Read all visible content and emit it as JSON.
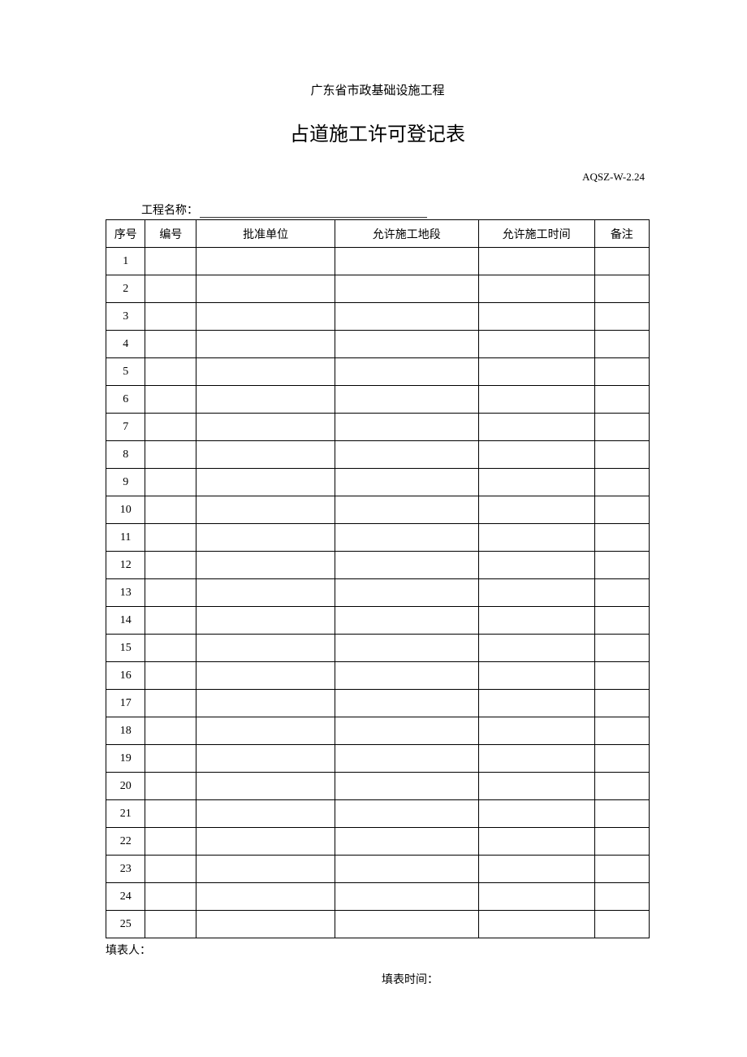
{
  "header": {
    "subtitle": "广东省市政基础设施工程",
    "title": "占道施工许可登记表",
    "doc_code": "AQSZ-W-2.24",
    "project_label": "工程名称："
  },
  "table": {
    "headers": {
      "seq": "序号",
      "num": "编号",
      "approver": "批准单位",
      "location": "允许施工地段",
      "time": "允许施工时间",
      "note": "备注"
    },
    "rows": [
      {
        "seq": "1",
        "num": "",
        "approver": "",
        "location": "",
        "time": "",
        "note": ""
      },
      {
        "seq": "2",
        "num": "",
        "approver": "",
        "location": "",
        "time": "",
        "note": ""
      },
      {
        "seq": "3",
        "num": "",
        "approver": "",
        "location": "",
        "time": "",
        "note": ""
      },
      {
        "seq": "4",
        "num": "",
        "approver": "",
        "location": "",
        "time": "",
        "note": ""
      },
      {
        "seq": "5",
        "num": "",
        "approver": "",
        "location": "",
        "time": "",
        "note": ""
      },
      {
        "seq": "6",
        "num": "",
        "approver": "",
        "location": "",
        "time": "",
        "note": ""
      },
      {
        "seq": "7",
        "num": "",
        "approver": "",
        "location": "",
        "time": "",
        "note": ""
      },
      {
        "seq": "8",
        "num": "",
        "approver": "",
        "location": "",
        "time": "",
        "note": ""
      },
      {
        "seq": "9",
        "num": "",
        "approver": "",
        "location": "",
        "time": "",
        "note": ""
      },
      {
        "seq": "10",
        "num": "",
        "approver": "",
        "location": "",
        "time": "",
        "note": ""
      },
      {
        "seq": "11",
        "num": "",
        "approver": "",
        "location": "",
        "time": "",
        "note": ""
      },
      {
        "seq": "12",
        "num": "",
        "approver": "",
        "location": "",
        "time": "",
        "note": ""
      },
      {
        "seq": "13",
        "num": "",
        "approver": "",
        "location": "",
        "time": "",
        "note": ""
      },
      {
        "seq": "14",
        "num": "",
        "approver": "",
        "location": "",
        "time": "",
        "note": ""
      },
      {
        "seq": "15",
        "num": "",
        "approver": "",
        "location": "",
        "time": "",
        "note": ""
      },
      {
        "seq": "16",
        "num": "",
        "approver": "",
        "location": "",
        "time": "",
        "note": ""
      },
      {
        "seq": "17",
        "num": "",
        "approver": "",
        "location": "",
        "time": "",
        "note": ""
      },
      {
        "seq": "18",
        "num": "",
        "approver": "",
        "location": "",
        "time": "",
        "note": ""
      },
      {
        "seq": "19",
        "num": "",
        "approver": "",
        "location": "",
        "time": "",
        "note": ""
      },
      {
        "seq": "20",
        "num": "",
        "approver": "",
        "location": "",
        "time": "",
        "note": ""
      },
      {
        "seq": "21",
        "num": "",
        "approver": "",
        "location": "",
        "time": "",
        "note": ""
      },
      {
        "seq": "22",
        "num": "",
        "approver": "",
        "location": "",
        "time": "",
        "note": ""
      },
      {
        "seq": "23",
        "num": "",
        "approver": "",
        "location": "",
        "time": "",
        "note": ""
      },
      {
        "seq": "24",
        "num": "",
        "approver": "",
        "location": "",
        "time": "",
        "note": ""
      },
      {
        "seq": "25",
        "num": "",
        "approver": "",
        "location": "",
        "time": "",
        "note": ""
      }
    ]
  },
  "footer": {
    "filler_label": "填表人：",
    "fill_time_label": "填表时间："
  }
}
